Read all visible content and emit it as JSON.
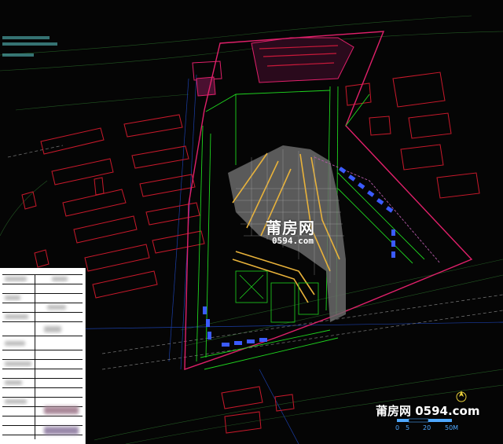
{
  "watermark": {
    "main_text": "莆房网",
    "sub_text": "0594.com",
    "corner_text": "莆房网 0594.com"
  },
  "scale_bar": {
    "labels": [
      "0",
      "5",
      "20",
      "50M"
    ]
  },
  "colors": {
    "background": "#050505",
    "building_outline": "#c8192b",
    "site_boundary": "#e0206a",
    "road_line": "#1fd51f",
    "parking_fill": "#8a8a8a",
    "parking_lane": "#e8b23a",
    "solar_panel": "#3b5bff",
    "scale_bar": "#4fa8ff"
  },
  "icons": {
    "compass": "north-arrow-icon"
  }
}
